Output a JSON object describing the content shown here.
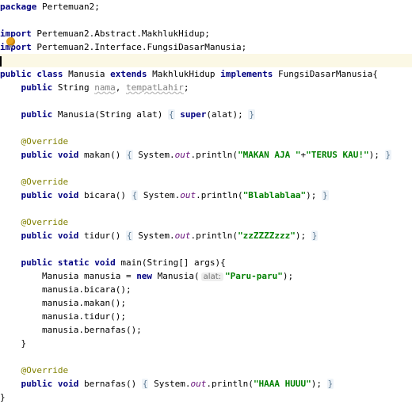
{
  "editor": {
    "lines": [
      [
        {
          "text": "package",
          "cls": "kw"
        },
        {
          "text": " Pertemuan2;"
        }
      ],
      [],
      [
        {
          "text": "import",
          "cls": "kw"
        },
        {
          "text": " Pertemuan2.Abstract.MakhlukHidup;"
        }
      ],
      [
        {
          "text": "import",
          "cls": "kw"
        },
        {
          "text": " Pertemuan2.Interface.FungsiDasarManusia;"
        }
      ],
      [],
      [
        {
          "text": "public class",
          "cls": "kw"
        },
        {
          "text": " Manusia "
        },
        {
          "text": "extends",
          "cls": "kw"
        },
        {
          "text": " MakhlukHidup "
        },
        {
          "text": "implements",
          "cls": "kw"
        },
        {
          "text": " FungsiDasarManusia{"
        }
      ],
      [
        {
          "text": "    "
        },
        {
          "text": "public",
          "cls": "kw"
        },
        {
          "text": " String "
        },
        {
          "text": "nama",
          "cls": "unused"
        },
        {
          "text": ", "
        },
        {
          "text": "tempatLahir",
          "cls": "unused"
        },
        {
          "text": ";"
        }
      ],
      [],
      [
        {
          "text": "    "
        },
        {
          "text": "public",
          "cls": "kw"
        },
        {
          "text": " Manusia(String alat) "
        },
        {
          "text": "{",
          "cls": "fold"
        },
        {
          "text": " "
        },
        {
          "text": "super",
          "cls": "kw"
        },
        {
          "text": "(alat); "
        },
        {
          "text": "}",
          "cls": "fold"
        }
      ],
      [],
      [
        {
          "text": "    "
        },
        {
          "text": "@Override",
          "cls": "ann"
        }
      ],
      [
        {
          "text": "    "
        },
        {
          "text": "public void",
          "cls": "kw"
        },
        {
          "text": " makan() "
        },
        {
          "text": "{",
          "cls": "fold"
        },
        {
          "text": " System."
        },
        {
          "text": "out",
          "cls": "sfld"
        },
        {
          "text": ".println("
        },
        {
          "text": "\"MAKAN AJA \"",
          "cls": "str"
        },
        {
          "text": "+"
        },
        {
          "text": "\"TERUS KAU!\"",
          "cls": "str"
        },
        {
          "text": "); "
        },
        {
          "text": "}",
          "cls": "fold"
        }
      ],
      [],
      [
        {
          "text": "    "
        },
        {
          "text": "@Override",
          "cls": "ann"
        }
      ],
      [
        {
          "text": "    "
        },
        {
          "text": "public void",
          "cls": "kw"
        },
        {
          "text": " bicara() "
        },
        {
          "text": "{",
          "cls": "fold"
        },
        {
          "text": " System."
        },
        {
          "text": "out",
          "cls": "sfld"
        },
        {
          "text": ".println("
        },
        {
          "text": "\"Blablablaa\"",
          "cls": "str"
        },
        {
          "text": "); "
        },
        {
          "text": "}",
          "cls": "fold"
        }
      ],
      [],
      [
        {
          "text": "    "
        },
        {
          "text": "@Override",
          "cls": "ann"
        }
      ],
      [
        {
          "text": "    "
        },
        {
          "text": "public void",
          "cls": "kw"
        },
        {
          "text": " tidur() "
        },
        {
          "text": "{",
          "cls": "fold"
        },
        {
          "text": " System."
        },
        {
          "text": "out",
          "cls": "sfld"
        },
        {
          "text": ".println("
        },
        {
          "text": "\"zzZZZZzzz\"",
          "cls": "str"
        },
        {
          "text": "); "
        },
        {
          "text": "}",
          "cls": "fold"
        }
      ],
      [],
      [
        {
          "text": "    "
        },
        {
          "text": "public static void",
          "cls": "kw"
        },
        {
          "text": " main(String[] args){"
        }
      ],
      [
        {
          "text": "        Manusia manusia = "
        },
        {
          "text": "new",
          "cls": "kw"
        },
        {
          "text": " Manusia("
        },
        {
          "text": "alat:",
          "cls": "hint"
        },
        {
          "text": "\"Paru-paru\"",
          "cls": "str"
        },
        {
          "text": ");"
        }
      ],
      [
        {
          "text": "        manusia.bicara();"
        }
      ],
      [
        {
          "text": "        manusia.makan();"
        }
      ],
      [
        {
          "text": "        manusia.tidur();"
        }
      ],
      [
        {
          "text": "        manusia.bernafas();"
        }
      ],
      [
        {
          "text": "    }"
        }
      ],
      [],
      [
        {
          "text": "    "
        },
        {
          "text": "@Override",
          "cls": "ann"
        }
      ],
      [
        {
          "text": "    "
        },
        {
          "text": "public void",
          "cls": "kw"
        },
        {
          "text": " bernafas() "
        },
        {
          "text": "{",
          "cls": "fold"
        },
        {
          "text": " System."
        },
        {
          "text": "out",
          "cls": "sfld"
        },
        {
          "text": ".println("
        },
        {
          "text": "\"HAAA HUUU\"",
          "cls": "str"
        },
        {
          "text": "); "
        },
        {
          "text": "}",
          "cls": "fold"
        }
      ],
      [
        {
          "text": "}"
        }
      ]
    ],
    "current_line_index": 4,
    "intention_icon": "lightbulb-icon",
    "colors": {
      "keyword": "#000080",
      "annotation": "#808000",
      "string": "#008000",
      "field": "#660e7a",
      "current_line_bg": "#fbf8e5",
      "fold": "#5d7a93"
    }
  }
}
